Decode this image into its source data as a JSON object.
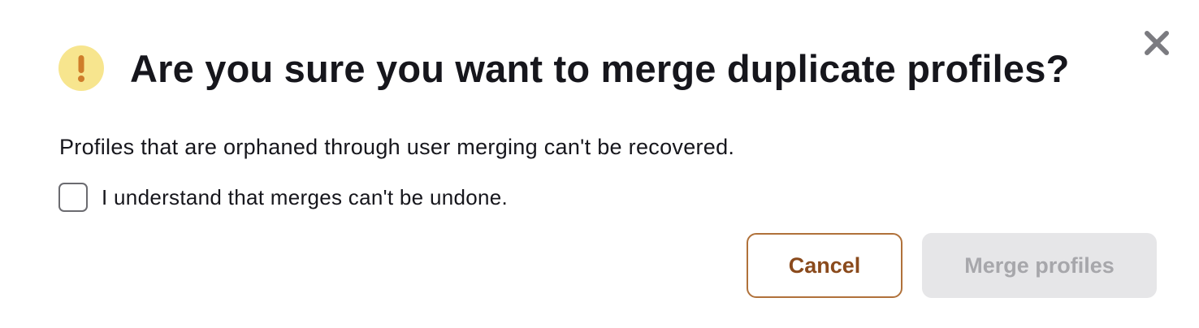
{
  "dialog": {
    "title": "Are you sure you want to merge duplicate profiles?",
    "message": "Profiles that are orphaned through user merging can't be recovered.",
    "confirm_label": "I understand that merges can't be undone.",
    "confirm_checked": false,
    "warning_icon": "exclamation-icon",
    "close_icon": "close-icon"
  },
  "buttons": {
    "cancel_label": "Cancel",
    "merge_label": "Merge profiles",
    "merge_disabled": true
  },
  "colors": {
    "warning_bg": "#f7e58e",
    "warning_fg": "#cf7d2a",
    "cancel_text": "#8a4a1c",
    "cancel_border": "#b0713a",
    "disabled_bg": "#e6e6e8",
    "disabled_text": "#a7a7ab",
    "close_icon": "#7b7b80",
    "text": "#16161c"
  }
}
